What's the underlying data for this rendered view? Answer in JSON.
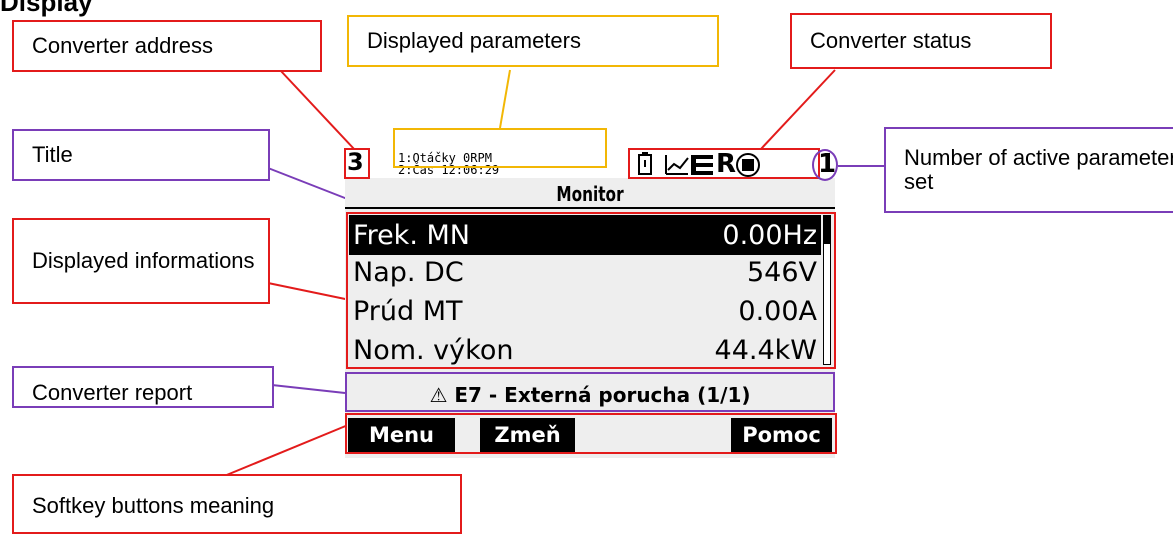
{
  "heading": "Display",
  "callouts": {
    "converter_address": "Converter address",
    "displayed_parameters": "Displayed parameters",
    "converter_status": "Converter status",
    "title": "Title",
    "active_set": "Number of active parameter set",
    "displayed_informations": "Displayed informations",
    "converter_report": "Converter report",
    "softkey_meaning": "Softkey buttons meaning"
  },
  "lcd": {
    "address": "3",
    "param_line1": "1:Otáčky 0RPM",
    "param_line2": "2:Čas 12:06:29",
    "status_letters": "R",
    "active_set": "1",
    "title": "Monitor",
    "rows": [
      {
        "label": "Frek. MN",
        "value": "0.00Hz"
      },
      {
        "label": "Nap. DC",
        "value": "546V"
      },
      {
        "label": "Prúd MT",
        "value": "0.00A"
      },
      {
        "label": "Nom. výkon",
        "value": "44.4kW"
      }
    ],
    "report": "⚠ E7 - Externá porucha (1/1)",
    "softkeys": [
      "Menu",
      "Zmeň",
      "Pomoc"
    ]
  },
  "colors": {
    "red": "#e31b1b",
    "yellow": "#f2b705",
    "purple": "#7a3db8"
  }
}
